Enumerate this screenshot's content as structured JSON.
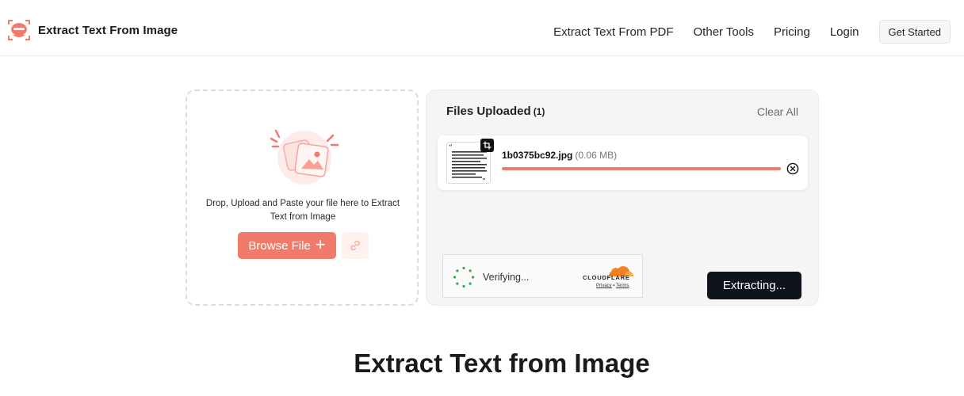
{
  "header": {
    "brand_name": "Extract Text From Image",
    "nav": [
      {
        "label": "Extract Text From PDF"
      },
      {
        "label": "Other Tools"
      },
      {
        "label": "Pricing"
      },
      {
        "label": "Login"
      }
    ],
    "cta_label": "Get Started"
  },
  "upload": {
    "instruction": "Drop, Upload and Paste your file here to Extract Text from Image",
    "browse_label": "Browse File",
    "browse_icon": "plus-icon",
    "link_icon": "link-icon"
  },
  "files": {
    "title": "Files Uploaded",
    "count": "(1)",
    "clear_all": "Clear All",
    "items": [
      {
        "name": "1b0375bc92.jpg",
        "size": "(0.06 MB)",
        "progress": 1.0
      }
    ]
  },
  "captcha": {
    "status": "Verifying...",
    "brand": "CLOUDFLARE",
    "privacy": "Privacy",
    "separator": "•",
    "terms": "Terms"
  },
  "extract_button": "Extracting...",
  "page_heading": "Extract Text from Image",
  "colors": {
    "accent": "#f07b6a",
    "dark_button": "#0f141c",
    "cloudflare_orange": "#f38020",
    "spinner_green": "#2fa84f"
  }
}
